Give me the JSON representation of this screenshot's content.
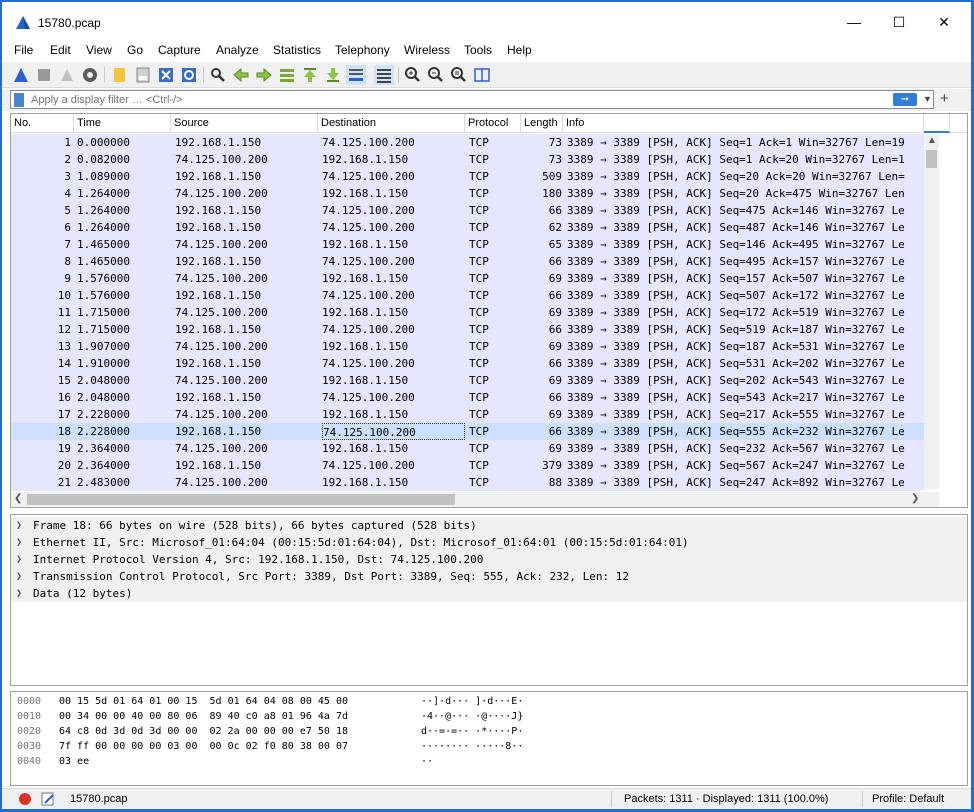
{
  "window": {
    "title": "15780.pcap"
  },
  "menu": [
    "File",
    "Edit",
    "View",
    "Go",
    "Capture",
    "Analyze",
    "Statistics",
    "Telephony",
    "Wireless",
    "Tools",
    "Help"
  ],
  "toolbar": {
    "icons": [
      "shark-fin-icon",
      "stop-icon",
      "restart-icon",
      "options-gear-icon",
      "open-folder-icon",
      "save-icon",
      "close-file-icon",
      "reload-icon",
      "find-icon",
      "back-arrow-icon",
      "forward-arrow-icon",
      "goto-packet-icon",
      "first-packet-icon",
      "last-packet-icon",
      "autoscroll-icon",
      "colorize-icon",
      "zoom-in-icon",
      "zoom-out-icon",
      "normal-size-icon",
      "resize-columns-icon"
    ]
  },
  "filter": {
    "placeholder": "Apply a display filter … <Ctrl-/>"
  },
  "packet_list": {
    "columns": [
      "No.",
      "Time",
      "Source",
      "Destination",
      "Protocol",
      "Length",
      "Info"
    ],
    "rows": [
      {
        "no": "1",
        "time": "0.000000",
        "src": "192.168.1.150",
        "dst": "74.125.100.200",
        "proto": "TCP",
        "len": "73",
        "info": "3389 → 3389 [PSH, ACK] Seq=1 Ack=1 Win=32767 Len=19"
      },
      {
        "no": "2",
        "time": "0.082000",
        "src": "74.125.100.200",
        "dst": "192.168.1.150",
        "proto": "TCP",
        "len": "73",
        "info": "3389 → 3389 [PSH, ACK] Seq=1 Ack=20 Win=32767 Len=1"
      },
      {
        "no": "3",
        "time": "1.089000",
        "src": "192.168.1.150",
        "dst": "74.125.100.200",
        "proto": "TCP",
        "len": "509",
        "info": "3389 → 3389 [PSH, ACK] Seq=20 Ack=20 Win=32767 Len="
      },
      {
        "no": "4",
        "time": "1.264000",
        "src": "74.125.100.200",
        "dst": "192.168.1.150",
        "proto": "TCP",
        "len": "180",
        "info": "3389 → 3389 [PSH, ACK] Seq=20 Ack=475 Win=32767 Len"
      },
      {
        "no": "5",
        "time": "1.264000",
        "src": "192.168.1.150",
        "dst": "74.125.100.200",
        "proto": "TCP",
        "len": "66",
        "info": "3389 → 3389 [PSH, ACK] Seq=475 Ack=146 Win=32767 Le"
      },
      {
        "no": "6",
        "time": "1.264000",
        "src": "192.168.1.150",
        "dst": "74.125.100.200",
        "proto": "TCP",
        "len": "62",
        "info": "3389 → 3389 [PSH, ACK] Seq=487 Ack=146 Win=32767 Le"
      },
      {
        "no": "7",
        "time": "1.465000",
        "src": "74.125.100.200",
        "dst": "192.168.1.150",
        "proto": "TCP",
        "len": "65",
        "info": "3389 → 3389 [PSH, ACK] Seq=146 Ack=495 Win=32767 Le"
      },
      {
        "no": "8",
        "time": "1.465000",
        "src": "192.168.1.150",
        "dst": "74.125.100.200",
        "proto": "TCP",
        "len": "66",
        "info": "3389 → 3389 [PSH, ACK] Seq=495 Ack=157 Win=32767 Le"
      },
      {
        "no": "9",
        "time": "1.576000",
        "src": "74.125.100.200",
        "dst": "192.168.1.150",
        "proto": "TCP",
        "len": "69",
        "info": "3389 → 3389 [PSH, ACK] Seq=157 Ack=507 Win=32767 Le"
      },
      {
        "no": "10",
        "time": "1.576000",
        "src": "192.168.1.150",
        "dst": "74.125.100.200",
        "proto": "TCP",
        "len": "66",
        "info": "3389 → 3389 [PSH, ACK] Seq=507 Ack=172 Win=32767 Le"
      },
      {
        "no": "11",
        "time": "1.715000",
        "src": "74.125.100.200",
        "dst": "192.168.1.150",
        "proto": "TCP",
        "len": "69",
        "info": "3389 → 3389 [PSH, ACK] Seq=172 Ack=519 Win=32767 Le"
      },
      {
        "no": "12",
        "time": "1.715000",
        "src": "192.168.1.150",
        "dst": "74.125.100.200",
        "proto": "TCP",
        "len": "66",
        "info": "3389 → 3389 [PSH, ACK] Seq=519 Ack=187 Win=32767 Le"
      },
      {
        "no": "13",
        "time": "1.907000",
        "src": "74.125.100.200",
        "dst": "192.168.1.150",
        "proto": "TCP",
        "len": "69",
        "info": "3389 → 3389 [PSH, ACK] Seq=187 Ack=531 Win=32767 Le"
      },
      {
        "no": "14",
        "time": "1.910000",
        "src": "192.168.1.150",
        "dst": "74.125.100.200",
        "proto": "TCP",
        "len": "66",
        "info": "3389 → 3389 [PSH, ACK] Seq=531 Ack=202 Win=32767 Le"
      },
      {
        "no": "15",
        "time": "2.048000",
        "src": "74.125.100.200",
        "dst": "192.168.1.150",
        "proto": "TCP",
        "len": "69",
        "info": "3389 → 3389 [PSH, ACK] Seq=202 Ack=543 Win=32767 Le"
      },
      {
        "no": "16",
        "time": "2.048000",
        "src": "192.168.1.150",
        "dst": "74.125.100.200",
        "proto": "TCP",
        "len": "66",
        "info": "3389 → 3389 [PSH, ACK] Seq=543 Ack=217 Win=32767 Le"
      },
      {
        "no": "17",
        "time": "2.228000",
        "src": "74.125.100.200",
        "dst": "192.168.1.150",
        "proto": "TCP",
        "len": "69",
        "info": "3389 → 3389 [PSH, ACK] Seq=217 Ack=555 Win=32767 Le"
      },
      {
        "no": "18",
        "time": "2.228000",
        "src": "192.168.1.150",
        "dst": "74.125.100.200",
        "proto": "TCP",
        "len": "66",
        "info": "3389 → 3389 [PSH, ACK] Seq=555 Ack=232 Win=32767 Le",
        "selected": true
      },
      {
        "no": "19",
        "time": "2.364000",
        "src": "74.125.100.200",
        "dst": "192.168.1.150",
        "proto": "TCP",
        "len": "69",
        "info": "3389 → 3389 [PSH, ACK] Seq=232 Ack=567 Win=32767 Le"
      },
      {
        "no": "20",
        "time": "2.364000",
        "src": "192.168.1.150",
        "dst": "74.125.100.200",
        "proto": "TCP",
        "len": "379",
        "info": "3389 → 3389 [PSH, ACK] Seq=567 Ack=247 Win=32767 Le"
      },
      {
        "no": "21",
        "time": "2.483000",
        "src": "74.125.100.200",
        "dst": "192.168.1.150",
        "proto": "TCP",
        "len": "88",
        "info": "3389 → 3389 [PSH, ACK] Seq=247 Ack=892 Win=32767 Le"
      }
    ]
  },
  "details": [
    "Frame 18: 66 bytes on wire (528 bits), 66 bytes captured (528 bits)",
    "Ethernet II, Src: Microsof_01:64:04 (00:15:5d:01:64:04), Dst: Microsof_01:64:01 (00:15:5d:01:64:01)",
    "Internet Protocol Version 4, Src: 192.168.1.150, Dst: 74.125.100.200",
    "Transmission Control Protocol, Src Port: 3389, Dst Port: 3389, Seq: 555, Ack: 232, Len: 12",
    "Data (12 bytes)"
  ],
  "bytes": [
    {
      "offset": "0000",
      "hex": "00 15 5d 01 64 01 00 15  5d 01 64 04 08 00 45 00",
      "ascii": "··]·d··· ]·d···E·"
    },
    {
      "offset": "0010",
      "hex": "00 34 00 00 40 00 80 06  89 40 c0 a8 01 96 4a 7d",
      "ascii": "·4··@··· ·@····J}"
    },
    {
      "offset": "0020",
      "hex": "64 c8 0d 3d 0d 3d 00 00  02 2a 00 00 00 e7 50 18",
      "ascii": "d··=·=·· ·*····P·"
    },
    {
      "offset": "0030",
      "hex": "7f ff 00 00 00 00 03 00  00 0c 02 f0 80 38 00 07",
      "ascii": "········ ·····8··"
    },
    {
      "offset": "0040",
      "hex": "03 ee",
      "ascii": "··"
    }
  ],
  "status": {
    "file": "15780.pcap",
    "packets": "Packets: 1311 · Displayed: 1311 (100.0%)",
    "profile": "Profile: Default"
  },
  "colors": {
    "row_bg": "#e7e6ff",
    "row_selected": "#cce0ff",
    "accent": "#2f7fd6"
  }
}
